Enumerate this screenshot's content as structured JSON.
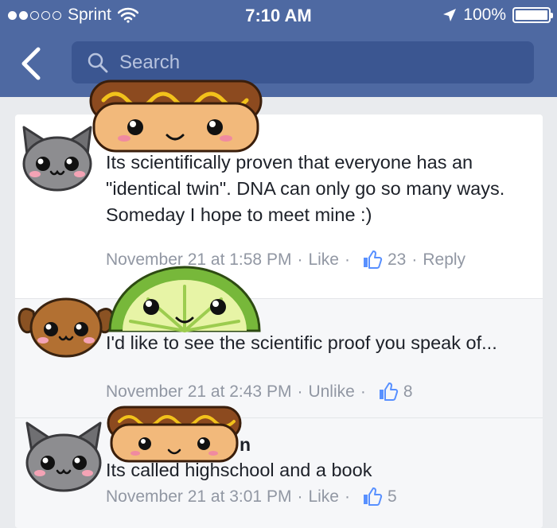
{
  "status_bar": {
    "carrier": "Sprint",
    "time": "7:10 AM",
    "battery": "100%"
  },
  "nav": {
    "search_placeholder": "Search"
  },
  "comments": [
    {
      "author": "",
      "text": "Its scientifically proven that everyone has an \"identical twin\". DNA can only go so many ways. Someday I hope to meet mine :)",
      "timestamp": "November 21 at 1:58 PM",
      "action": "Like",
      "likes": "23",
      "reply": "Reply"
    },
    {
      "author": "",
      "text": "I'd like to see the scientific proof you speak of...",
      "timestamp": "November 21 at 2:43 PM",
      "action": "Unlike",
      "likes": "8"
    },
    {
      "author": "n",
      "text": "Its called highschool and a book",
      "timestamp": "November 21 at 3:01 PM",
      "action": "Like",
      "likes": "5"
    }
  ],
  "colors": {
    "nav_blue": "#4e69a2",
    "search_bg": "#3b5691",
    "like_blue": "#5890ff",
    "meta_gray": "#9197a3"
  }
}
